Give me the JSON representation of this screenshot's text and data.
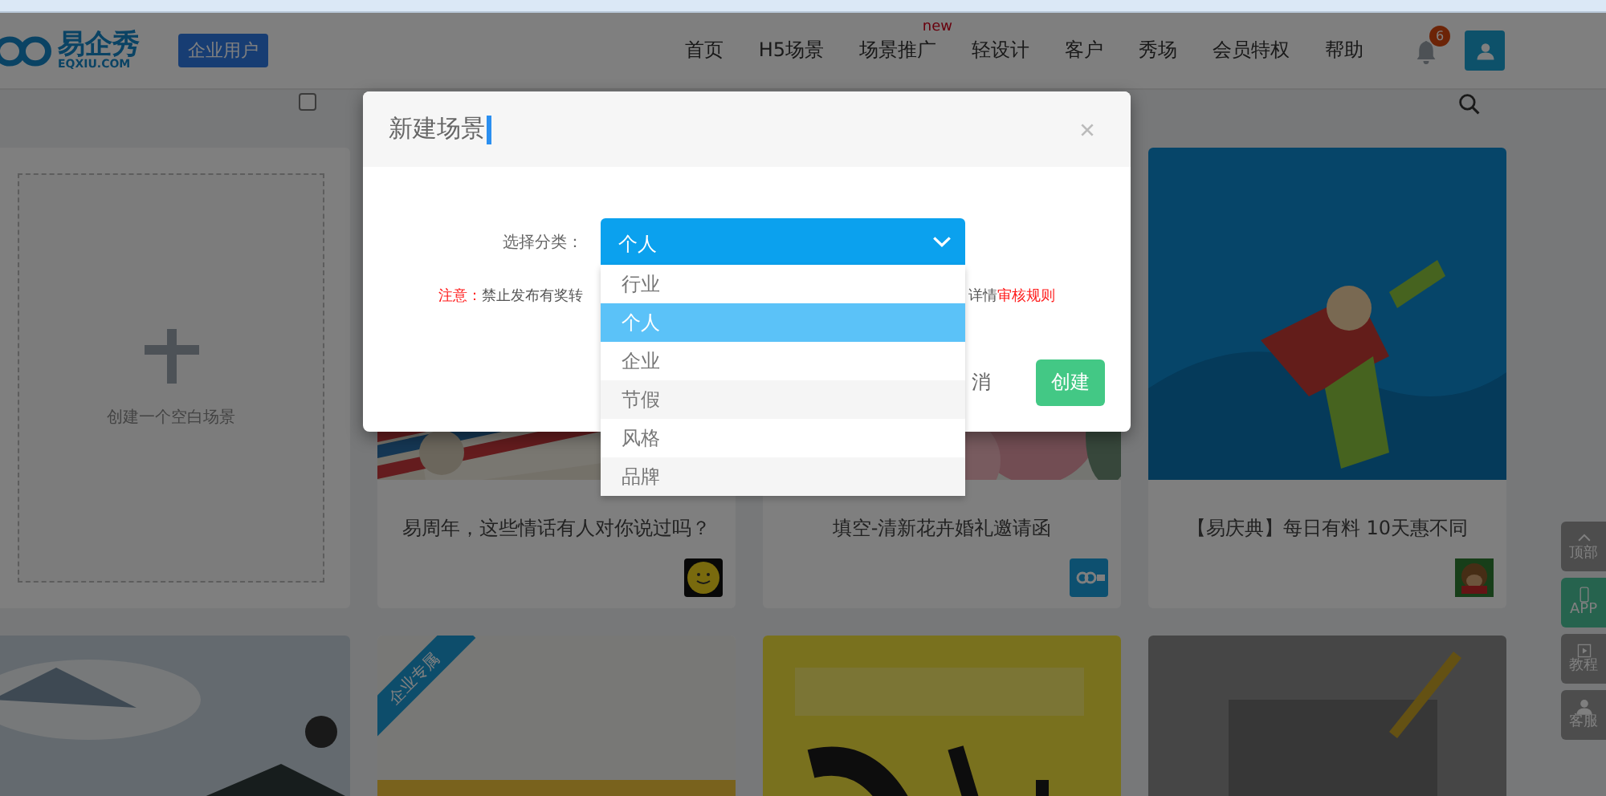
{
  "header": {
    "logo": {
      "name": "易企秀",
      "domain": "EQXIU.COM"
    },
    "account_badge": "企业用户",
    "nav": [
      {
        "label": "首页"
      },
      {
        "label": "H5场景"
      },
      {
        "label": "场景推广",
        "badge": "new"
      },
      {
        "label": "轻设计"
      },
      {
        "label": "客户"
      },
      {
        "label": "秀场"
      },
      {
        "label": "会员特权"
      },
      {
        "label": "帮助"
      }
    ],
    "notifications": {
      "count": "6"
    }
  },
  "toolbar": {
    "filter_checkbox": {
      "checked": false
    }
  },
  "cards": [
    {
      "kind": "create",
      "label": "创建一个空白场景"
    },
    {
      "kind": "scene",
      "title": "易周年，这些情话有人对你说过吗？",
      "avatar": {
        "kind": "smiley"
      }
    },
    {
      "kind": "scene",
      "title": "填空-清新花卉婚礼邀请函",
      "avatar": {
        "kind": "brand"
      }
    },
    {
      "kind": "scene",
      "title": "【易庆典】每日有料 10天惠不同"
    },
    {
      "kind": "preview"
    },
    {
      "kind": "preview",
      "ribbon": "企业专属"
    },
    {
      "kind": "preview"
    },
    {
      "kind": "preview"
    }
  ],
  "side_buttons": [
    {
      "label": "顶部",
      "kind": "top",
      "selected": false
    },
    {
      "label": "APP",
      "kind": "app",
      "selected": true
    },
    {
      "label": "教程",
      "kind": "video",
      "selected": false
    },
    {
      "label": "客服",
      "kind": "person",
      "selected": false
    }
  ],
  "modal": {
    "title": "新建场景",
    "category_label": "选择分类：",
    "select": {
      "value": "个人",
      "expanded": true
    },
    "options": [
      {
        "label": "行业",
        "selected": false
      },
      {
        "label": "个人",
        "selected": true
      },
      {
        "label": "企业",
        "selected": false
      },
      {
        "label": "节假",
        "selected": false
      },
      {
        "label": "风格",
        "selected": false
      },
      {
        "label": "品牌",
        "selected": false
      }
    ],
    "notice": {
      "left": [
        {
          "text": "注意：",
          "kind": "warning"
        },
        {
          "text": "禁止发布有奖转",
          "kind": "plain"
        }
      ],
      "right": [
        {
          "text": "详情",
          "kind": "plain"
        },
        {
          "text": "审核规则",
          "kind": "link"
        }
      ]
    },
    "buttons": [
      {
        "label": "消",
        "kind": "cancel"
      },
      {
        "label": "创建",
        "kind": "primary"
      }
    ]
  }
}
